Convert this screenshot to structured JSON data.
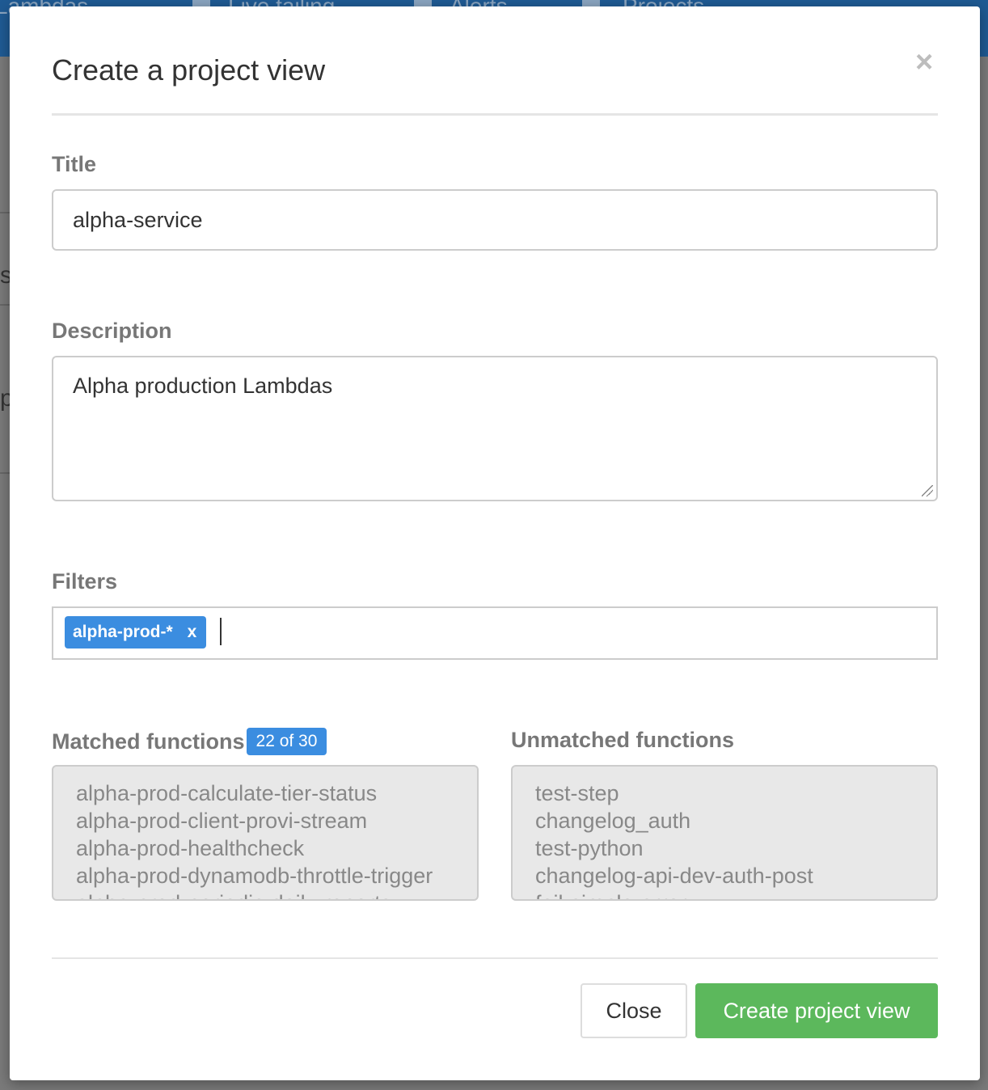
{
  "background": {
    "nav_items": [
      {
        "label": "Lambdas"
      },
      {
        "label": "Live tailing"
      },
      {
        "label": "Alerts"
      },
      {
        "label": "Projects"
      }
    ],
    "fragments": [
      "s",
      "p"
    ]
  },
  "modal": {
    "title": "Create a project view",
    "close_symbol": "×",
    "title_field": {
      "label": "Title",
      "value": "alpha-service"
    },
    "description_field": {
      "label": "Description",
      "value": "Alpha production Lambdas"
    },
    "filters": {
      "label": "Filters",
      "tags": [
        {
          "text": "alpha-prod-*",
          "remove": "x"
        }
      ]
    },
    "matched": {
      "label": "Matched functions",
      "badge": "22 of 30",
      "items": [
        "alpha-prod-calculate-tier-status",
        "alpha-prod-client-provi-stream",
        "alpha-prod-healthcheck",
        "alpha-prod-dynamodb-throttle-trigger",
        "alpha-prod-periodic-daily-reports"
      ]
    },
    "unmatched": {
      "label": "Unmatched functions",
      "items": [
        "test-step",
        "changelog_auth",
        "test-python",
        "changelog-api-dev-auth-post",
        "fail-simple-error"
      ]
    },
    "buttons": {
      "close": "Close",
      "create": "Create project view"
    }
  },
  "colors": {
    "accent_blue": "#3b8de0",
    "success_green": "#5cb85c",
    "topbar": "#1f5a93"
  }
}
